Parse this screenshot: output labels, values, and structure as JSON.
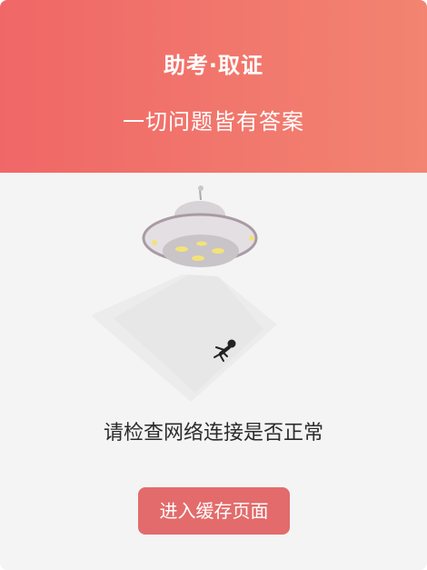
{
  "header": {
    "title": "助考·取证",
    "subtitle": "一切问题皆有答案"
  },
  "illustration": {
    "icon": "ufo-abduction-icon"
  },
  "message": "请检查网络连接是否正常",
  "actions": {
    "cache_button_label": "进入缓存页面"
  },
  "colors": {
    "header_gradient_start": "#f06767",
    "header_gradient_end": "#f28471",
    "button_background": "#e36b6b",
    "page_background": "#f4f4f4"
  }
}
